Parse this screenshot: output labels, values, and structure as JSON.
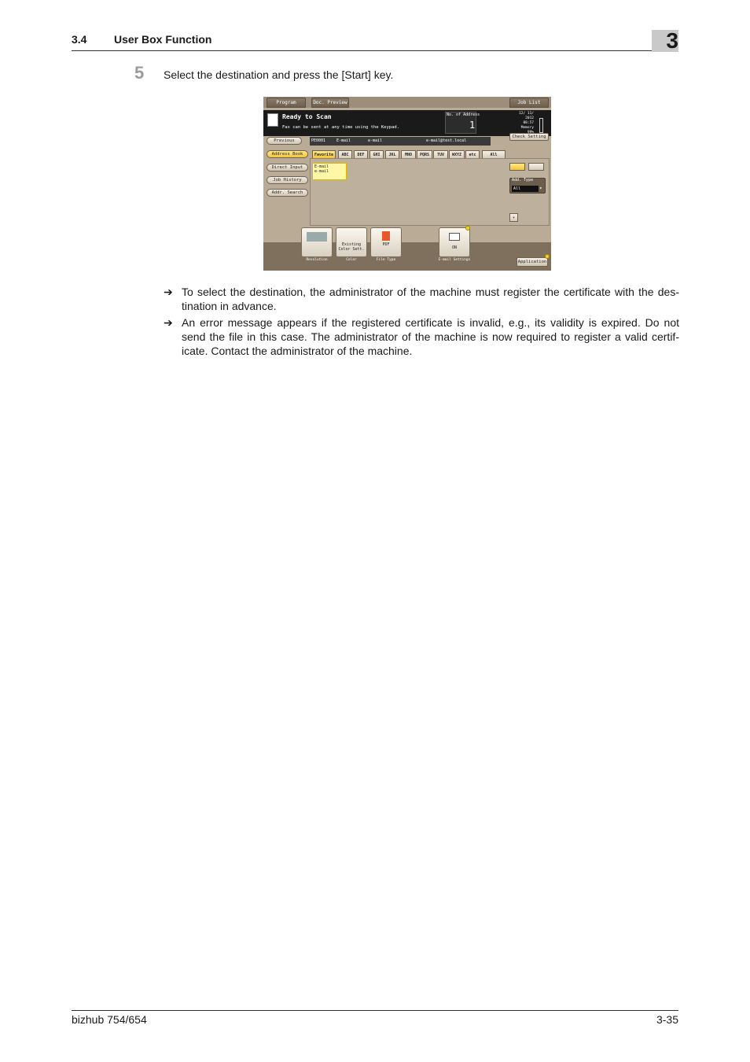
{
  "header": {
    "section_number": "3.4",
    "section_title": "User Box Function",
    "chapter": "3"
  },
  "step": {
    "number": "5",
    "text": "Select the destination and press the [Start] key."
  },
  "notes": [
    {
      "arrow": "➔",
      "text": "To select the destination, the administrator of the machine must register the certificate with the des-tination in advance."
    },
    {
      "arrow": "➔",
      "text": "An error message appears if the registered certificate is invalid, e.g., its validity is expired. Do not send the file in this case. The administrator of the machine is now required to register a valid certif-icate. Contact the administrator of the machine."
    }
  ],
  "footer": {
    "model": "bizhub 754/654",
    "page": "3-35"
  },
  "screen": {
    "tabs": {
      "program": "Program",
      "doc_preview": "Doc. Preview",
      "job_list": "Job List"
    },
    "status": {
      "title": "Ready to Scan",
      "subtitle": "Fax can be sent at any time using the Keypad."
    },
    "address_count": {
      "label": "No. of Address",
      "value": "1"
    },
    "datetime": {
      "date": "12/ 11/ 2012",
      "time": "08:57"
    },
    "memory": {
      "label": "Memory",
      "value": "99%"
    },
    "check_setting": "Check Setting",
    "previous": "Previous",
    "filter": {
      "id": "PE0001",
      "type": "E-mail",
      "name": "e-mail",
      "address": "e-mail@test.local"
    },
    "side_menu": [
      "Address Book",
      "Direct Input",
      "Job History",
      "Addr. Search"
    ],
    "index_tabs": [
      "Favorite",
      "ABC",
      "DEF",
      "GHI",
      "JKL",
      "MNO",
      "PQRS",
      "TUV",
      "WXYZ",
      "etc",
      "All"
    ],
    "entry": {
      "line1": "E-mail",
      "line2": "e-mail"
    },
    "add_type": {
      "label": "Add. Type",
      "value": "All"
    },
    "functions": [
      {
        "button": "",
        "label": "Resolution"
      },
      {
        "button": "Existing Color Sett.",
        "label": "Color"
      },
      {
        "button": "PDF",
        "label": "File Type"
      },
      {
        "button": "ON",
        "label": "E-mail Settings"
      }
    ],
    "application": "Application"
  }
}
